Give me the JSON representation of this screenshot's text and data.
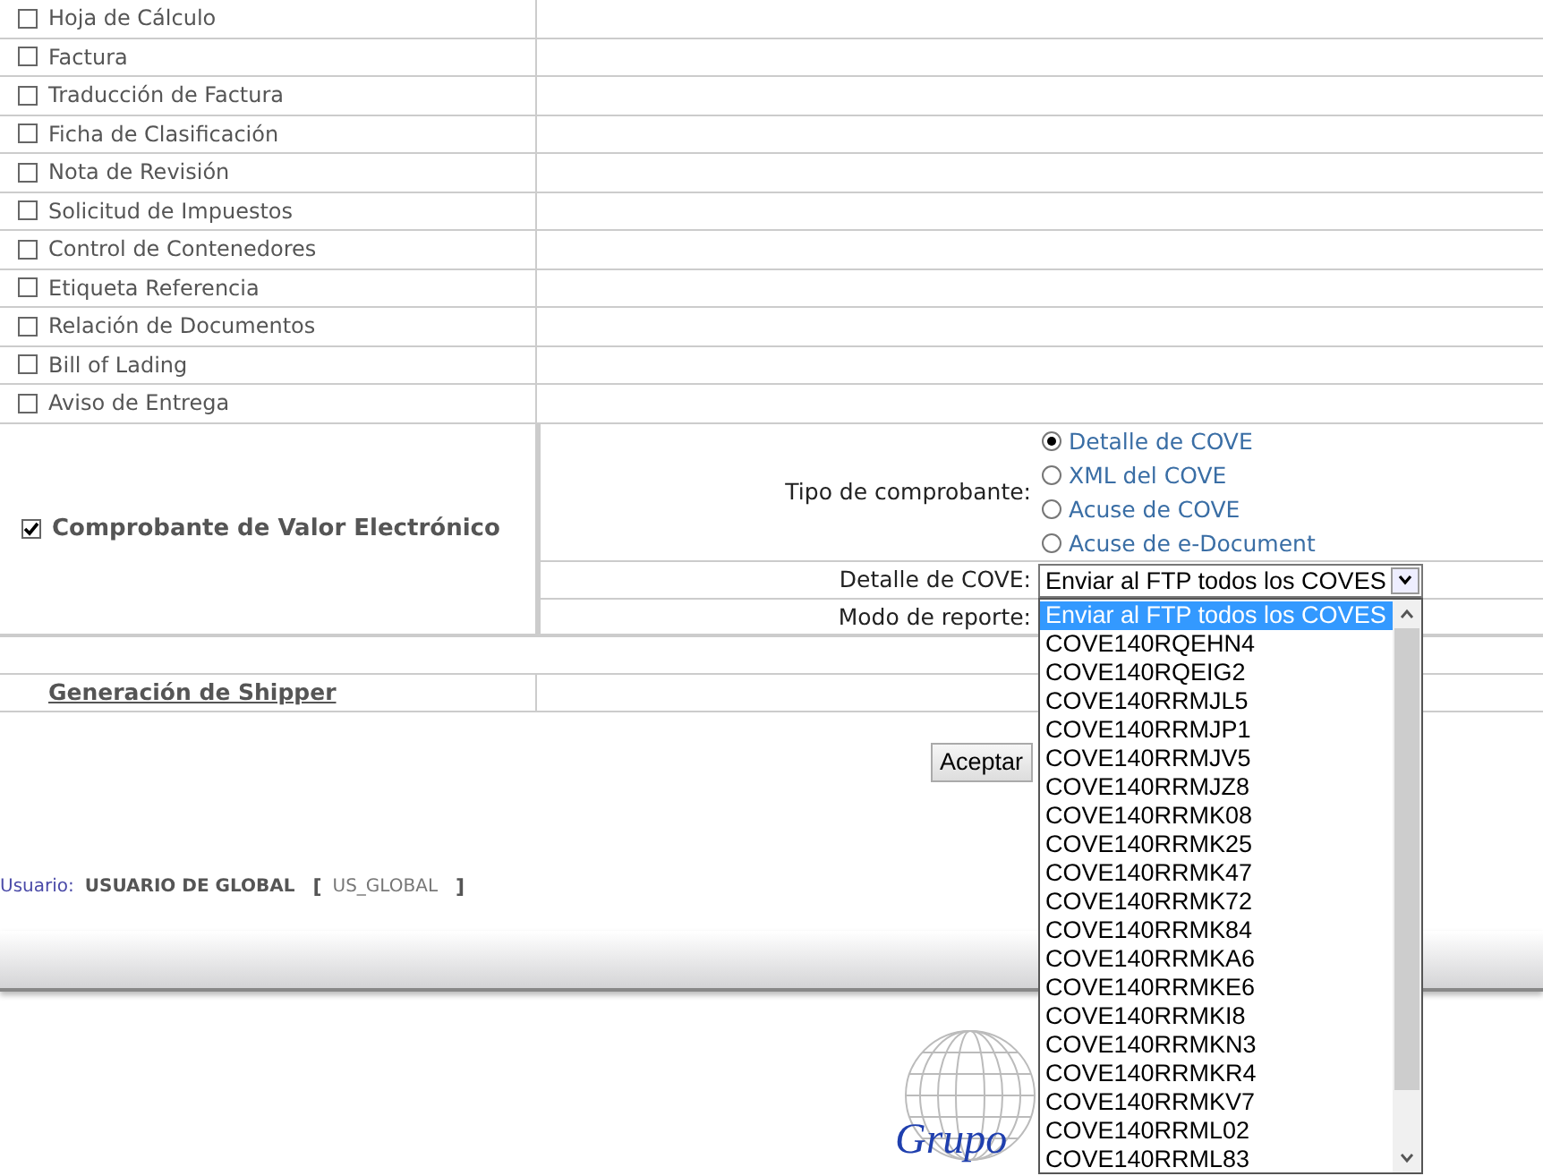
{
  "documents": [
    {
      "label": "Hoja de Cálculo",
      "checked": false
    },
    {
      "label": "Factura",
      "checked": false
    },
    {
      "label": "Traducción de Factura",
      "checked": false
    },
    {
      "label": "Ficha de Clasificación",
      "checked": false
    },
    {
      "label": "Nota de Revisión",
      "checked": false
    },
    {
      "label": "Solicitud de Impuestos",
      "checked": false
    },
    {
      "label": "Control de Contenedores",
      "checked": false
    },
    {
      "label": "Etiqueta Referencia",
      "checked": false
    },
    {
      "label": "Relación de Documentos",
      "checked": false
    },
    {
      "label": "Bill of Lading",
      "checked": false
    },
    {
      "label": "Aviso de Entrega",
      "checked": false
    }
  ],
  "cove": {
    "label": "Comprobante de Valor Electrónico",
    "checked": true,
    "fields": [
      {
        "kind": "radio",
        "label": "Tipo de comprobante:",
        "options": [
          {
            "label": "Detalle de COVE",
            "selected": true
          },
          {
            "label": "XML del COVE",
            "selected": false
          },
          {
            "label": "Acuse de COVE",
            "selected": false
          },
          {
            "label": "Acuse de e-Document",
            "selected": false
          }
        ]
      },
      {
        "kind": "select",
        "label": "Detalle de COVE:",
        "value": "Enviar al FTP todos los COVES"
      },
      {
        "kind": "empty",
        "label": "Modo de reporte:"
      }
    ]
  },
  "dropdown": {
    "options": [
      {
        "label": "Enviar al FTP todos los COVES",
        "selected": true
      },
      {
        "label": "COVE140RQEHN4",
        "selected": false
      },
      {
        "label": "COVE140RQEIG2",
        "selected": false
      },
      {
        "label": "COVE140RRMJL5",
        "selected": false
      },
      {
        "label": "COVE140RRMJP1",
        "selected": false
      },
      {
        "label": "COVE140RRMJV5",
        "selected": false
      },
      {
        "label": "COVE140RRMJZ8",
        "selected": false
      },
      {
        "label": "COVE140RRMK08",
        "selected": false
      },
      {
        "label": "COVE140RRMK25",
        "selected": false
      },
      {
        "label": "COVE140RRMK47",
        "selected": false
      },
      {
        "label": "COVE140RRMK72",
        "selected": false
      },
      {
        "label": "COVE140RRMK84",
        "selected": false
      },
      {
        "label": "COVE140RRMKA6",
        "selected": false
      },
      {
        "label": "COVE140RRMKE6",
        "selected": false
      },
      {
        "label": "COVE140RRMKI8",
        "selected": false
      },
      {
        "label": "COVE140RRMKN3",
        "selected": false
      },
      {
        "label": "COVE140RRMKR4",
        "selected": false
      },
      {
        "label": "COVE140RRMKV7",
        "selected": false
      },
      {
        "label": "COVE140RRML02",
        "selected": false
      },
      {
        "label": "COVE140RRML83",
        "selected": false
      }
    ]
  },
  "shipper_link": "Generación de Shipper",
  "accept_button": "Aceptar",
  "user": {
    "label": "Usuario:",
    "name": "USUARIO DE GLOBAL",
    "open_bracket": "[",
    "code": "US_GLOBAL",
    "close_bracket": "]"
  },
  "logo": {
    "text": "Grupo"
  }
}
